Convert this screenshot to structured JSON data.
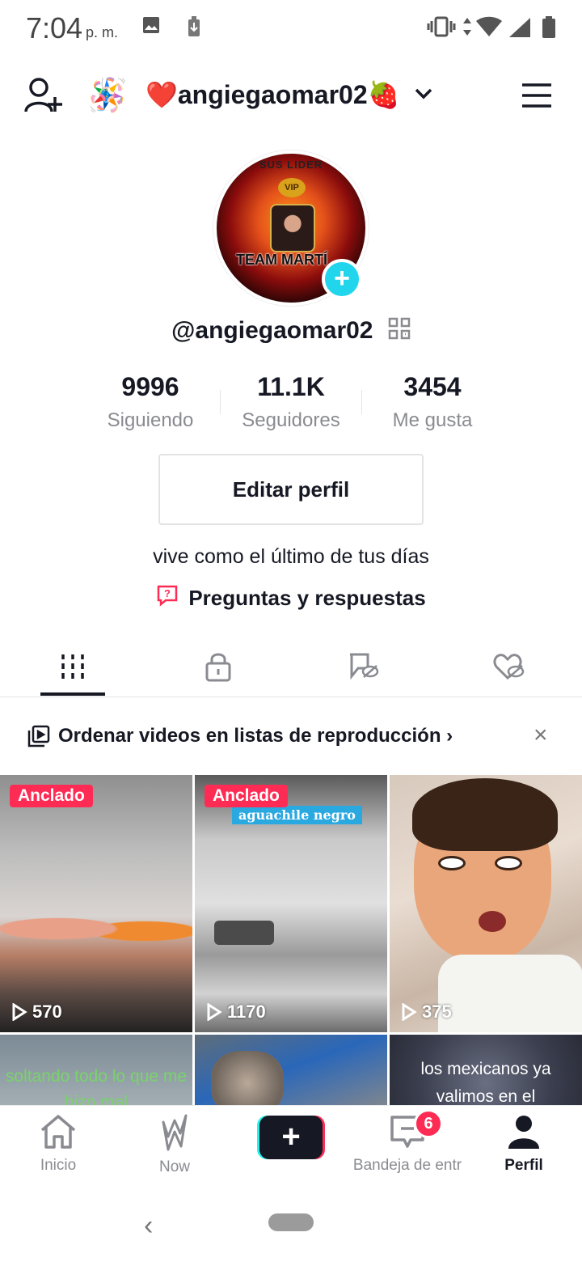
{
  "status_bar": {
    "time": "7:04",
    "ampm": "p. m.",
    "icons": [
      "image-icon",
      "download-icon",
      "vibrate-icon",
      "data-arrows-icon",
      "wifi-icon",
      "signal-icon",
      "battery-icon"
    ]
  },
  "header": {
    "username_label": "❤️angiegaomar02🍓",
    "pinata_emoji": "🪅",
    "icons": [
      "add-user-icon",
      "chevron-down-icon",
      "menu-icon"
    ]
  },
  "avatar": {
    "crown_text": "SUS LIDER",
    "vip_text": "VIP",
    "team_text": "TEAM MARTÍ",
    "plus_symbol": "+"
  },
  "profile": {
    "handle": "@angiegaomar02",
    "bio": "vive como el último de tus días",
    "qa_label": "Preguntas y respuestas",
    "edit_button": "Editar perfil"
  },
  "stats": [
    {
      "value": "9996",
      "label": "Siguiendo"
    },
    {
      "value": "11.1K",
      "label": "Seguidores"
    },
    {
      "value": "3454",
      "label": "Me gusta"
    }
  ],
  "tabs": [
    "videos-grid-icon",
    "private-lock-icon",
    "reposts-hidden-icon",
    "liked-hidden-icon"
  ],
  "banner": {
    "text": "Ordenar videos en listas de reproducción",
    "chevron": "›",
    "close": "×"
  },
  "videos": [
    {
      "pinned": "Anclado",
      "views": "570"
    },
    {
      "pinned": "Anclado",
      "views": "1170",
      "caption": "aguachile negro"
    },
    {
      "views": "375"
    },
    {
      "overlay": "soltando todo lo que me hizo mal"
    },
    {},
    {
      "overlay": "los mexicanos ya valimos en el"
    }
  ],
  "bottom_nav": [
    {
      "label": "Inicio",
      "icon": "home-icon"
    },
    {
      "label": "Now",
      "icon": "now-icon"
    },
    {
      "label": "",
      "icon": "create-plus-icon"
    },
    {
      "label": "Bandeja de entr",
      "icon": "inbox-icon",
      "badge": "6"
    },
    {
      "label": "Perfil",
      "icon": "profile-icon"
    }
  ],
  "create_plus": "+",
  "system_nav": {
    "back": "‹"
  },
  "colors": {
    "accent": "#fe2c55",
    "cyan": "#25f4ee",
    "plus_blue": "#20d5ec",
    "text": "#161823",
    "muted": "#8a8b91"
  }
}
